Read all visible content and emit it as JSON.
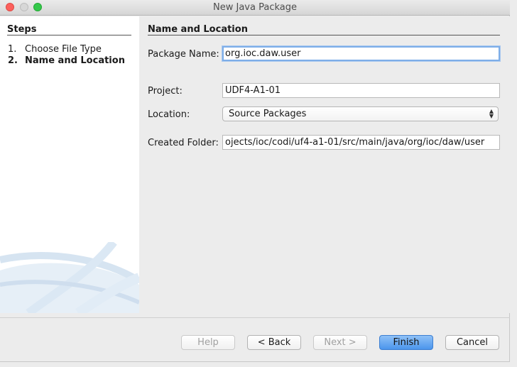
{
  "window": {
    "title": "New Java Package"
  },
  "steps": {
    "heading": "Steps",
    "items": [
      {
        "num": "1.",
        "label": "Choose File Type"
      },
      {
        "num": "2.",
        "label": "Name and Location"
      }
    ]
  },
  "form": {
    "heading": "Name and Location",
    "package_name": {
      "label": "Package Name:",
      "value": "org.ioc.daw.user"
    },
    "project": {
      "label": "Project:",
      "value": "UDF4-A1-01"
    },
    "location": {
      "label": "Location:",
      "value": "Source Packages"
    },
    "created_folder": {
      "label": "Created Folder:",
      "value": "ojects/ioc/codi/uf4-a1-01/src/main/java/org/ioc/daw/user"
    }
  },
  "buttons": {
    "help": "Help",
    "back": "< Back",
    "next": "Next >",
    "finish": "Finish",
    "cancel": "Cancel"
  }
}
